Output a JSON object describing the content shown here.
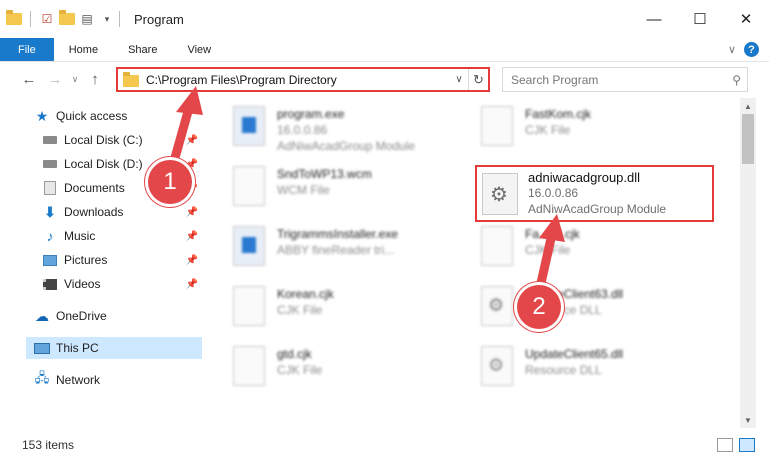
{
  "window": {
    "title": "Program",
    "minimize_glyph": "—",
    "maximize_glyph": "☐",
    "close_glyph": "✕"
  },
  "ribbon": {
    "tabs": [
      {
        "label": "File"
      },
      {
        "label": "Home"
      },
      {
        "label": "Share"
      },
      {
        "label": "View"
      }
    ],
    "help_glyph": "?",
    "collapse_glyph": "∨"
  },
  "address": {
    "back_glyph": "←",
    "forward_glyph": "→",
    "recent_glyph": "∨",
    "up_glyph": "↑",
    "path": "C:\\Program Files\\Program Directory",
    "dropdown_glyph": "∨",
    "refresh_glyph": "↻"
  },
  "search": {
    "placeholder": "Search Program",
    "icon_glyph": "⚲"
  },
  "nav": {
    "items": [
      {
        "label": "Quick access",
        "icon": "star-icon",
        "pinned": false
      },
      {
        "label": "Local Disk (C:)",
        "icon": "drive-icon",
        "pinned": true
      },
      {
        "label": "Local Disk (D:)",
        "icon": "drive-icon",
        "pinned": true
      },
      {
        "label": "Documents",
        "icon": "documents-icon",
        "pinned": true
      },
      {
        "label": "Downloads",
        "icon": "downloads-icon",
        "pinned": true
      },
      {
        "label": "Music",
        "icon": "music-icon",
        "pinned": true
      },
      {
        "label": "Pictures",
        "icon": "pictures-icon",
        "pinned": true
      },
      {
        "label": "Videos",
        "icon": "videos-icon",
        "pinned": true
      },
      {
        "label": "OneDrive",
        "icon": "cloud-icon",
        "pinned": false
      },
      {
        "label": "This PC",
        "icon": "computer-icon",
        "pinned": false,
        "selected": true
      },
      {
        "label": "Network",
        "icon": "network-icon",
        "pinned": false
      }
    ],
    "pin_glyph": "📌"
  },
  "files": [
    {
      "name": "program.exe",
      "line2": "16.0.0.86",
      "line3": "AdNiwAcadGroup Module",
      "icon": "exe-icon"
    },
    {
      "name": "FastKom.cjk",
      "line2": "CJK File",
      "icon": "file-icon"
    },
    {
      "name": "SndToWP13.wcm",
      "line2": "WCM File",
      "icon": "file-icon"
    },
    {
      "name": "TrigrammsInstaller.exe",
      "line2": "ABBY fineReader tri...",
      "icon": "exe-icon"
    },
    {
      "name": "Fa...ml.cjk",
      "line2": "CJK File",
      "icon": "file-icon"
    },
    {
      "name": "Korean.cjk",
      "line2": "CJK File",
      "icon": "file-icon"
    },
    {
      "name": "UpdateClient63.dll",
      "line2": "Resource DLL",
      "icon": "gear-icon"
    },
    {
      "name": "gtd.cjk",
      "line2": "CJK File",
      "icon": "file-icon"
    },
    {
      "name": "UpdateClient65.dll",
      "line2": "Resource DLL",
      "icon": "gear-icon"
    }
  ],
  "highlighted_file": {
    "name": "adniwacadgroup.dll",
    "version": "16.0.0.86",
    "description": "AdNiwAcadGroup Module"
  },
  "status": {
    "item_count": "153 items"
  },
  "markers": {
    "step1": "1",
    "step2": "2"
  },
  "colors": {
    "accent": "#1979ca",
    "highlight_border": "#e33a3a",
    "marker_fill": "#e3474a"
  }
}
